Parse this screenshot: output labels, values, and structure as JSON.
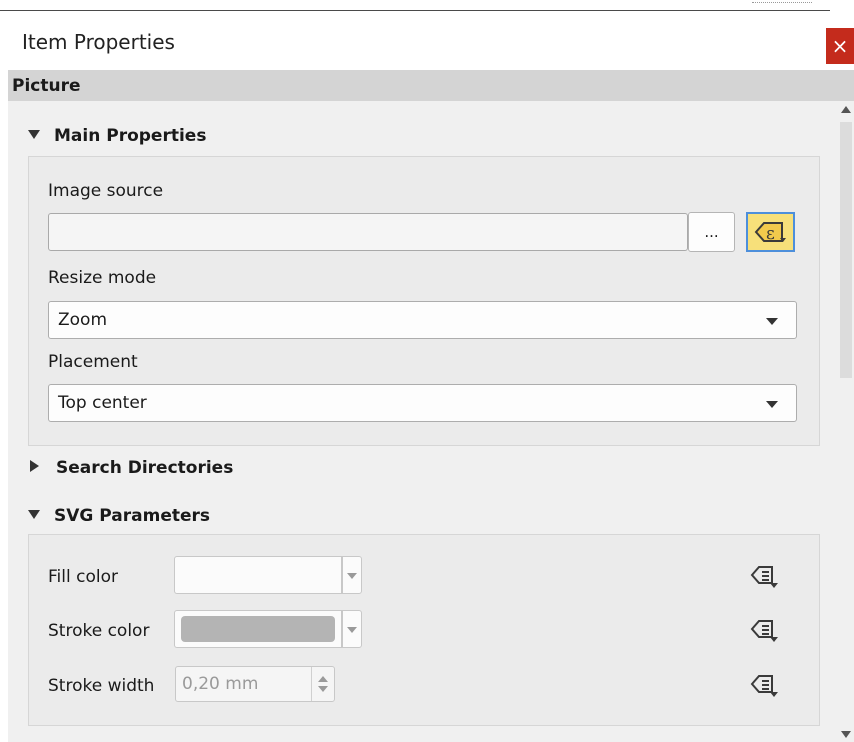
{
  "window": {
    "title": "Item Properties",
    "close_label": "×"
  },
  "panel": {
    "header": "Picture",
    "main_properties": {
      "title": "Main Properties",
      "image_source_label": "Image source",
      "image_source_value": "",
      "browse_label": "...",
      "resize_mode_label": "Resize mode",
      "resize_mode_value": "Zoom",
      "placement_label": "Placement",
      "placement_value": "Top center"
    },
    "search_directories": {
      "title": "Search Directories"
    },
    "svg_parameters": {
      "title": "SVG Parameters",
      "fill_color_label": "Fill color",
      "stroke_color_label": "Stroke color",
      "stroke_color": "#b4b4b4",
      "stroke_width_label": "Stroke width",
      "stroke_width_value": "0,20 mm"
    }
  },
  "icons": {
    "expression": "data-defined-override-icon",
    "close": "close-icon"
  },
  "colors": {
    "close_button": "#c42b1c",
    "panel_header": "#d4d4d4",
    "expr_active_bg": "#f7dc6f",
    "expr_active_border": "#4d8fdb"
  }
}
